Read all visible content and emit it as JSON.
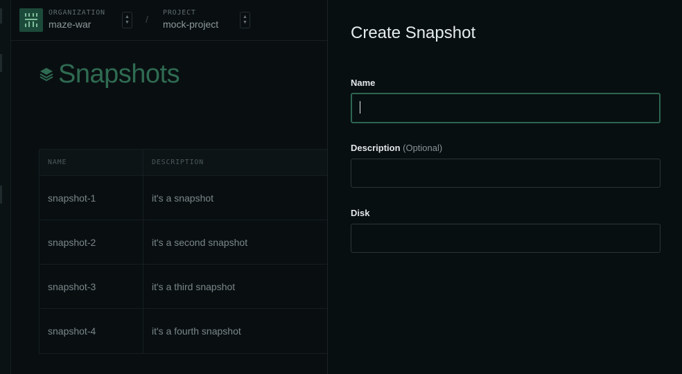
{
  "topbar": {
    "org_label": "ORGANIZATION",
    "org_value": "maze-war",
    "separator": "/",
    "project_label": "PROJECT",
    "project_value": "mock-project",
    "switcher_up": "▲",
    "switcher_down": "▼"
  },
  "page": {
    "title": "Snapshots",
    "table": {
      "columns": [
        "NAME",
        "DESCRIPTION"
      ],
      "rows": [
        {
          "name": "snapshot-1",
          "description": "it's a snapshot"
        },
        {
          "name": "snapshot-2",
          "description": "it's a second snapshot"
        },
        {
          "name": "snapshot-3",
          "description": "it's a third snapshot"
        },
        {
          "name": "snapshot-4",
          "description": "it's a fourth snapshot"
        }
      ]
    }
  },
  "modal": {
    "title": "Create Snapshot",
    "fields": {
      "name": {
        "label": "Name",
        "value": "",
        "placeholder": ""
      },
      "description": {
        "label": "Description",
        "optional": "(Optional)",
        "value": "",
        "placeholder": ""
      },
      "disk": {
        "label": "Disk",
        "value": "",
        "placeholder": ""
      }
    }
  },
  "colors": {
    "accent": "#2f6b52",
    "focus_border": "#2d6651",
    "background": "#080f11",
    "logo_bg": "#1c4a3a"
  },
  "icons": {
    "org_logo": "maze-logo-icon",
    "title_icon": "layers-stack-icon",
    "switcher": "chevron-up-down-icon"
  }
}
